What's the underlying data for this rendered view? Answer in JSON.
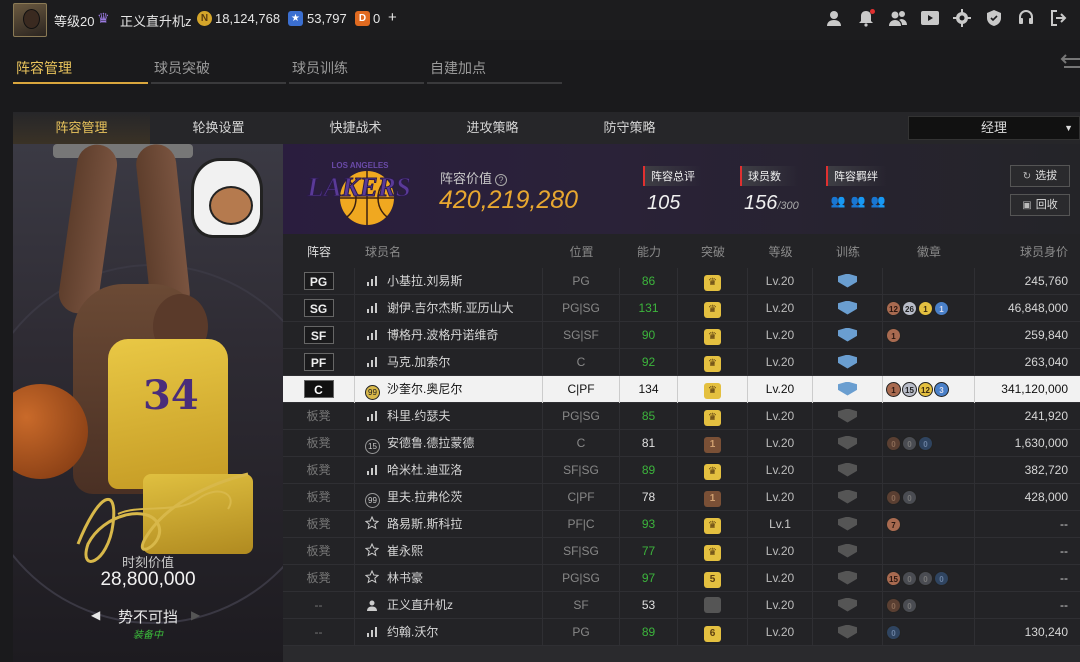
{
  "topbar": {
    "level": "等级20",
    "username": "正义直升机z",
    "coins": "18,124,768",
    "stars": "53,797",
    "tickets": "0",
    "plus": "+",
    "colors": {
      "coin": "#d4a52a",
      "star": "#3b6fd0",
      "ticket": "#e06a20",
      "vip": "#7a5ad0"
    },
    "icons": [
      "profile-icon",
      "bell-icon",
      "friends-icon",
      "video-icon",
      "settings-icon",
      "shield-icon",
      "headset-icon",
      "exit-icon"
    ]
  },
  "tabs_primary": [
    "阵容管理",
    "球员突破",
    "球员训练",
    "自建加点"
  ],
  "tabs_secondary": [
    "阵容管理",
    "轮换设置",
    "快捷战术",
    "进攻策略",
    "防守策略"
  ],
  "role_select": {
    "value": "经理"
  },
  "player_card": {
    "value_label": "时刻价值",
    "value": "28,800,000",
    "trait": "势不可挡",
    "status": "装备中",
    "jersey_number": "34"
  },
  "team_header": {
    "logo_text": "LAKERS",
    "logo_city": "LOS ANGELES",
    "value_label": "阵容价值",
    "value": "420,219,280",
    "rating_label": "阵容总评",
    "rating": "105",
    "count_label": "球员数",
    "count": "156",
    "count_max": "/300",
    "synergy_label": "阵容羁绊",
    "btn_options": "选拔",
    "btn_recycle": "回收"
  },
  "table": {
    "headers": [
      "阵容",
      "球员名",
      "位置",
      "能力",
      "突破",
      "等级",
      "训练",
      "徽章",
      "球员身价"
    ],
    "rows": [
      {
        "slot": "PG",
        "icon": "bars",
        "name": "小基拉.刘易斯",
        "pos": "PG",
        "ovr": "86",
        "ovr_green": true,
        "brk": "gold",
        "lvl": "Lv.20",
        "trn": "on",
        "badges": [],
        "salary": "245,760"
      },
      {
        "slot": "SG",
        "icon": "bars",
        "name": "谢伊.吉尔杰斯.亚历山大",
        "pos": "PG|SG",
        "ovr": "131",
        "ovr_green": true,
        "brk": "gold",
        "lvl": "Lv.20",
        "trn": "on",
        "badges": [
          [
            "bronze",
            "12"
          ],
          [
            "silver",
            "26"
          ],
          [
            "gold",
            "1"
          ],
          [
            "blue",
            "1"
          ]
        ],
        "salary": "46,848,000"
      },
      {
        "slot": "SF",
        "icon": "bars",
        "name": "博格丹.波格丹诺维奇",
        "pos": "SG|SF",
        "ovr": "90",
        "ovr_green": true,
        "brk": "gold",
        "lvl": "Lv.20",
        "trn": "on",
        "badges": [
          [
            "bronze",
            "1"
          ]
        ],
        "salary": "259,840"
      },
      {
        "slot": "PF",
        "icon": "bars",
        "name": "马克.加索尔",
        "pos": "C",
        "ovr": "92",
        "ovr_green": true,
        "brk": "gold",
        "lvl": "Lv.20",
        "trn": "on",
        "badges": [],
        "salary": "263,040"
      },
      {
        "slot": "C",
        "icon": "99",
        "name": "沙奎尔.奥尼尔",
        "pos": "C|PF",
        "ovr": "134",
        "ovr_green": false,
        "brk": "gold",
        "lvl": "Lv.20",
        "trn": "on",
        "badges": [
          [
            "bronze",
            "1"
          ],
          [
            "silver",
            "15"
          ],
          [
            "gold",
            "12"
          ],
          [
            "blue",
            "3"
          ]
        ],
        "salary": "341,120,000",
        "selected": true
      },
      {
        "slot": "板凳",
        "icon": "bars",
        "name": "科里.约瑟夫",
        "pos": "PG|SG",
        "ovr": "85",
        "ovr_green": true,
        "brk": "gold",
        "lvl": "Lv.20",
        "trn": "off",
        "badges": [],
        "salary": "241,920"
      },
      {
        "slot": "板凳",
        "icon": "15",
        "name": "安德鲁.德拉蒙德",
        "pos": "C",
        "ovr": "81",
        "ovr_green": false,
        "brk": "brown",
        "lvl": "Lv.20",
        "trn": "off",
        "badges": [
          [
            "dbronze",
            "0"
          ],
          [
            "dsilver",
            "0"
          ],
          [
            "dblue",
            "0"
          ]
        ],
        "salary": "1,630,000"
      },
      {
        "slot": "板凳",
        "icon": "bars",
        "name": "哈米杜.迪亚洛",
        "pos": "SF|SG",
        "ovr": "89",
        "ovr_green": true,
        "brk": "gold",
        "lvl": "Lv.20",
        "trn": "off",
        "badges": [],
        "salary": "382,720"
      },
      {
        "slot": "板凳",
        "icon": "99",
        "name": "里夫.拉弗伦茨",
        "pos": "C|PF",
        "ovr": "78",
        "ovr_green": false,
        "brk": "brown",
        "lvl": "Lv.20",
        "trn": "off",
        "badges": [
          [
            "dbronze",
            "0"
          ],
          [
            "dsilver",
            "0"
          ]
        ],
        "salary": "428,000"
      },
      {
        "slot": "板凳",
        "icon": "star",
        "name": "路易斯.斯科拉",
        "pos": "PF|C",
        "ovr": "93",
        "ovr_green": true,
        "brk": "gold",
        "lvl": "Lv.1",
        "trn": "off",
        "badges": [
          [
            "bronze",
            "7"
          ]
        ],
        "salary": "--"
      },
      {
        "slot": "板凳",
        "icon": "star",
        "name": "崔永熙",
        "pos": "SF|SG",
        "ovr": "77",
        "ovr_green": true,
        "brk": "gold",
        "lvl": "Lv.20",
        "trn": "off",
        "badges": [],
        "salary": "--"
      },
      {
        "slot": "板凳",
        "icon": "star",
        "name": "林书豪",
        "pos": "PG|SG",
        "ovr": "97",
        "ovr_green": true,
        "brk": "gold5",
        "lvl": "Lv.20",
        "trn": "off",
        "badges": [
          [
            "bronze",
            "15"
          ],
          [
            "dsilver",
            "0"
          ],
          [
            "dsilver",
            "0"
          ],
          [
            "dblue",
            "0"
          ]
        ],
        "salary": "--"
      },
      {
        "slot": "--",
        "icon": "user",
        "name": "正义直升机z",
        "pos": "SF",
        "ovr": "53",
        "ovr_green": false,
        "brk": "gray",
        "lvl": "Lv.20",
        "trn": "off",
        "badges": [
          [
            "dbronze",
            "0"
          ],
          [
            "dsilver",
            "0"
          ]
        ],
        "salary": "--"
      },
      {
        "slot": "--",
        "icon": "bars",
        "name": "约翰.沃尔",
        "pos": "PG",
        "ovr": "89",
        "ovr_green": true,
        "brk": "gold6",
        "lvl": "Lv.20",
        "trn": "off",
        "badges": [
          [
            "dblue",
            "0"
          ]
        ],
        "salary": "130,240"
      }
    ]
  }
}
